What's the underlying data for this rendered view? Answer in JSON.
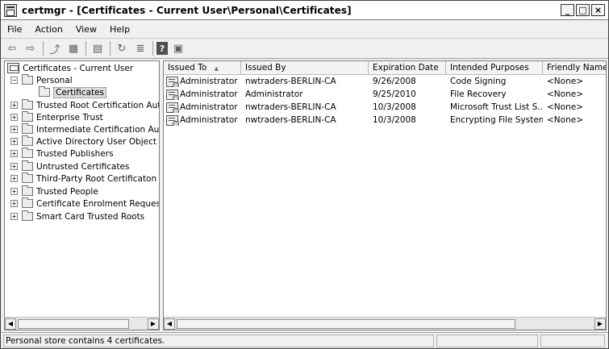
{
  "window": {
    "title": "certmgr - [Certificates - Current User\\Personal\\Certificates]",
    "app_icon": "certmgr-icon",
    "controls": {
      "minimize": "_",
      "maximize": "□",
      "close": "×"
    }
  },
  "menu": {
    "items": [
      "File",
      "Action",
      "View",
      "Help"
    ]
  },
  "toolbar": {
    "buttons": [
      {
        "icon": "back-arrow-icon",
        "glyph": "⇦"
      },
      {
        "icon": "forward-arrow-icon",
        "glyph": "⇨"
      },
      {
        "icon": "up-level-icon",
        "glyph": "⤴"
      },
      {
        "icon": "show-hide-tree-icon",
        "glyph": "▦"
      },
      {
        "icon": "clipboard-icon",
        "glyph": "▤"
      },
      {
        "icon": "refresh-icon",
        "glyph": "↻"
      },
      {
        "icon": "export-list-icon",
        "glyph": "≣"
      },
      {
        "icon": "help-icon",
        "glyph": "?"
      },
      {
        "icon": "properties-icon",
        "glyph": "▣"
      }
    ]
  },
  "tree": {
    "root": "Certificates - Current User",
    "nodes": [
      {
        "label": "Personal",
        "expander": "−"
      },
      {
        "label": "Certificates",
        "expander": ""
      },
      {
        "label": "Trusted Root Certification Autho",
        "expander": "+"
      },
      {
        "label": "Enterprise Trust",
        "expander": "+"
      },
      {
        "label": "Intermediate Certification Autho",
        "expander": "+"
      },
      {
        "label": "Active Directory User Object",
        "expander": "+"
      },
      {
        "label": "Trusted Publishers",
        "expander": "+"
      },
      {
        "label": "Untrusted Certificates",
        "expander": "+"
      },
      {
        "label": "Third-Party Root Certificaton Au",
        "expander": "+"
      },
      {
        "label": "Trusted People",
        "expander": "+"
      },
      {
        "label": "Certificate Enrolment Requests",
        "expander": "+"
      },
      {
        "label": "Smart Card Trusted Roots",
        "expander": "+"
      }
    ]
  },
  "list": {
    "columns": [
      "Issued To",
      "Issued By",
      "Expiration Date",
      "Intended Purposes",
      "Friendly Name"
    ],
    "sort_indicator": "▲",
    "rows": [
      [
        "Administrator",
        "nwtraders-BERLIN-CA",
        "9/26/2008",
        "Code Signing",
        "<None>"
      ],
      [
        "Administrator",
        "Administrator",
        "9/25/2010",
        "File Recovery",
        "<None>"
      ],
      [
        "Administrator",
        "nwtraders-BERLIN-CA",
        "10/3/2008",
        "Microsoft Trust List S...",
        "<None>"
      ],
      [
        "Administrator",
        "nwtraders-BERLIN-CA",
        "10/3/2008",
        "Encrypting File System",
        "<None>"
      ]
    ]
  },
  "scroll": {
    "left": "◀",
    "right": "▶"
  },
  "status": {
    "text": "Personal store contains 4 certificates."
  }
}
